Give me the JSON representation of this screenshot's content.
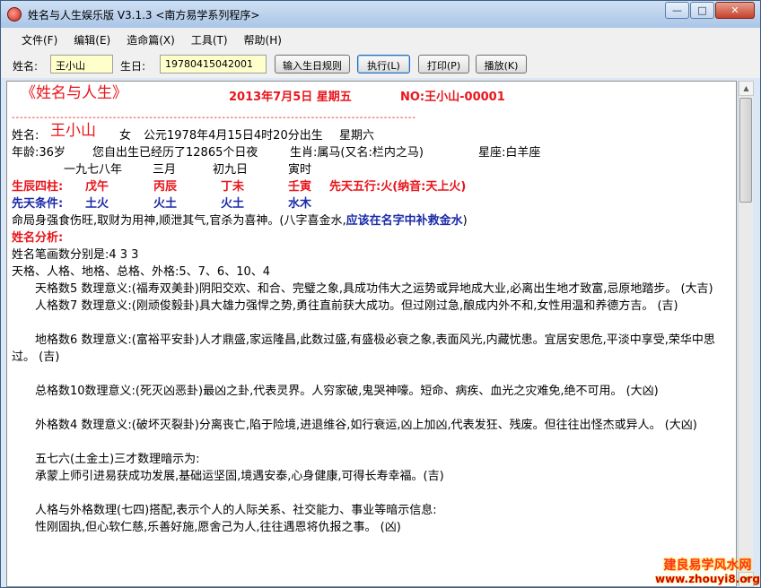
{
  "window": {
    "title": "姓名与人生娱乐版 V3.1.3     <南方易学系列程序>"
  },
  "menu": [
    "文件(F)",
    "编辑(E)",
    "造命篇(X)",
    "工具(T)",
    "帮助(H)"
  ],
  "toolbar": {
    "name_label": "姓名:",
    "name_value": "王小山",
    "birth_label": "生日:",
    "birth_value": "19780415042001",
    "btn_rule": "输入生日规则",
    "btn_exec": "执行(L)",
    "btn_print": "打印(P)",
    "btn_play": "播放(K)"
  },
  "doc": {
    "title": "《姓名与人生》",
    "date": "2013年7月5日   星期五",
    "no": "NO:王小山-00001",
    "divider": "----------------------------------------------------------------------------------------------------",
    "l_name_label": "姓名:",
    "l_name": "王小山",
    "l_gender": "女",
    "l_born": "公元1978年4月15日4时20分出生",
    "l_weekday": "星期六",
    "l_age": "年龄:36岁",
    "l_days": "您自出生已经历了12865个日夜",
    "l_zodiac": "生肖:属马(又名:栏内之马)",
    "l_star": "星座:白羊座",
    "lunar": [
      "一九七八年",
      "三月",
      "初九日",
      "寅时"
    ],
    "pillars_label": "生辰四柱:",
    "pillars": [
      "戊午",
      "丙辰",
      "丁未",
      "壬寅"
    ],
    "five_label": "先天五行:火(纳音:天上火)",
    "cond_label": "先天条件:",
    "cond": [
      "土火",
      "火土",
      "火土",
      "水木"
    ],
    "fate_a": "命局身强食伤旺,取财为用神,顺泄其气,官杀为喜神。(八字喜金水,",
    "fate_b": "应该在名字中补救金水",
    "fate_c": ")",
    "analysis": "姓名分析:",
    "strokes": "姓名笔画数分别是:4 3 3",
    "grids": "天格、人格、地格、总格、外格:5、7、6、10、4",
    "p1": "天格数5 数理意义:(福寿双美卦)阴阳交欢、和合、完璧之象,具成功伟大之运势或异地成大业,必离出生地才致富,忌原地踏步。  (大吉)",
    "p2": "人格数7 数理意义:(刚顽俊毅卦)具大雄力强悍之势,勇往直前获大成功。但过刚过急,酿成内外不和,女性用温和养德方吉。  (吉)",
    "p3": "地格数6 数理意义:(富裕平安卦)人才鼎盛,家运隆昌,此数过盛,有盛极必衰之象,表面风光,内藏忧患。宜居安思危,平淡中享受,荣华中思过。  (吉)",
    "p4": "总格数10数理意义:(死灭凶恶卦)最凶之卦,代表灵界。人穷家破,鬼哭神嚎。短命、病疾、血光之灾难免,绝不可用。  (大凶)",
    "p5": "外格数4 数理意义:(破坏灭裂卦)分离丧亡,陷于险境,进退维谷,如行衰运,凶上加凶,代表发狂、残废。但往往出怪杰或异人。  (大凶)",
    "p6a": "五七六(土金土)三才数理暗示为:",
    "p6b": "承蒙上师引进易获成功发展,基础运坚固,境遇安泰,心身健康,可得长寿幸福。(吉)",
    "p7a": "人格与外格数理(七四)搭配,表示个人的人际关系、社交能力、事业等暗示信息:",
    "p7b": "性刚固执,但心软仁慈,乐善好施,愿舍己为人,往往遇恩将仇报之事。  (凶)"
  },
  "watermark": {
    "line1": "建良易学风水网",
    "line2": "www.zhouyi8.org"
  },
  "icons": {
    "app": "app-logo-icon",
    "minimize": "minimize-icon",
    "maximize": "maximize-icon",
    "close": "close-icon"
  },
  "colors": {
    "accent_red": "#e8151b",
    "accent_blue": "#1b2ba8",
    "input_bg": "#ffffcc"
  }
}
